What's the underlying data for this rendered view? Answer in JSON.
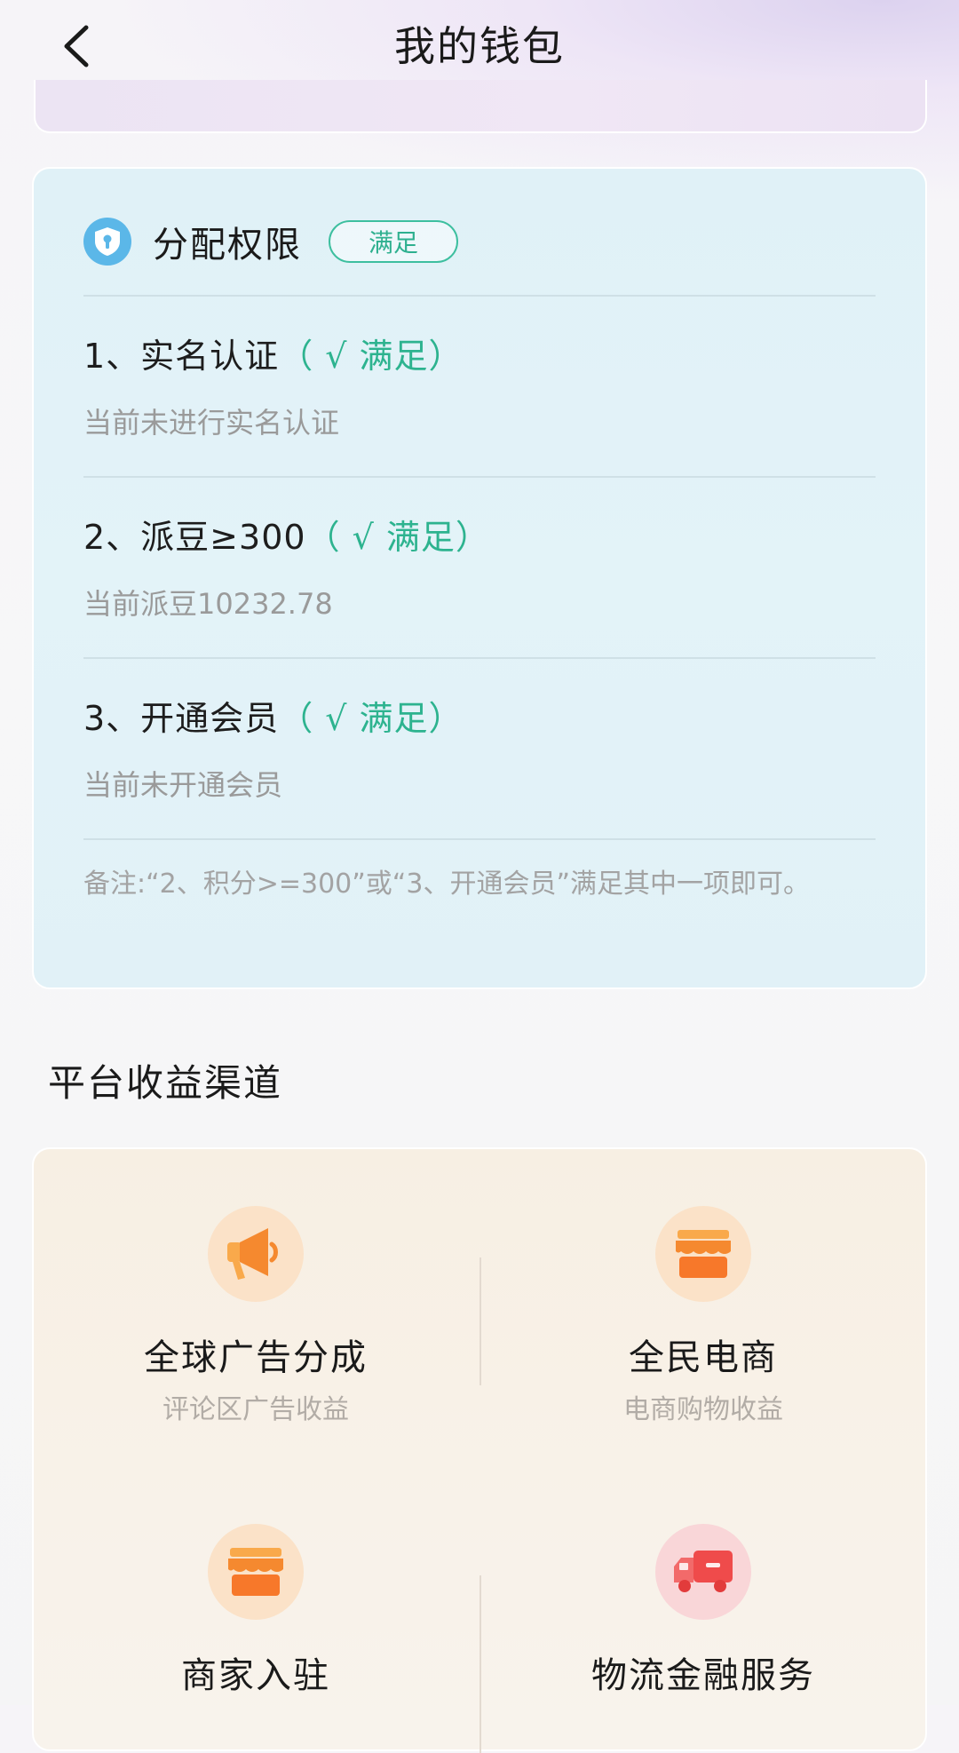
{
  "header": {
    "title": "我的钱包"
  },
  "permission": {
    "title": "分配权限",
    "badge": "满足",
    "requirements": [
      {
        "title": "1、实名认证",
        "status": "（ √ 满足）",
        "desc": "当前未进行实名认证"
      },
      {
        "title": "2、派豆≥300",
        "status": "（ √ 满足）",
        "desc": "当前派豆10232.78"
      },
      {
        "title": "3、开通会员",
        "status": "（ √ 满足）",
        "desc": "当前未开通会员"
      }
    ],
    "note": "备注:“2、积分>=300”或“3、开通会员”满足其中一项即可。"
  },
  "channels": {
    "section_title": "平台收益渠道",
    "items": [
      {
        "name": "全球广告分成",
        "desc": "评论区广告收益",
        "icon": "megaphone-icon"
      },
      {
        "name": "全民电商",
        "desc": "电商购物收益",
        "icon": "store-icon"
      },
      {
        "name": "商家入驻",
        "desc": "",
        "icon": "store-icon"
      },
      {
        "name": "物流金融服务",
        "desc": "",
        "icon": "truck-icon"
      }
    ]
  },
  "colors": {
    "accent_green": "#2db38f",
    "shield_blue": "#5bb7e8",
    "orange": "#f5892f",
    "red": "#ef4b4b"
  }
}
